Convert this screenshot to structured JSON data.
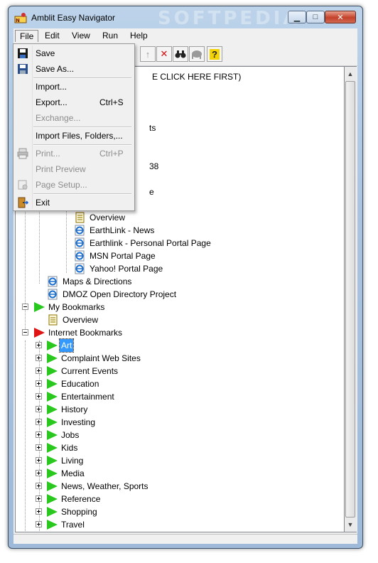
{
  "window": {
    "title": "Amblit Easy Navigator",
    "watermark": "SOFTPEDIA"
  },
  "menubar": [
    "File",
    "Edit",
    "View",
    "Run",
    "Help"
  ],
  "file_menu": [
    {
      "label": "Save",
      "shortcut": "",
      "enabled": true,
      "icon": "floppy-disk-icon"
    },
    {
      "label": "Save As...",
      "shortcut": "",
      "enabled": true,
      "icon": "save-as-icon"
    },
    {
      "label": "Import...",
      "shortcut": "",
      "enabled": true
    },
    {
      "label": "Export...",
      "shortcut": "Ctrl+S",
      "enabled": true
    },
    {
      "label": "Exchange...",
      "shortcut": "",
      "enabled": false
    },
    {
      "label": "Import Files, Folders,...",
      "shortcut": "",
      "enabled": true
    },
    {
      "label": "Print...",
      "shortcut": "Ctrl+P",
      "enabled": false,
      "icon": "printer-icon"
    },
    {
      "label": "Print Preview",
      "shortcut": "",
      "enabled": false
    },
    {
      "label": "Page Setup...",
      "shortcut": "",
      "enabled": false,
      "icon": "page-setup-icon"
    },
    {
      "label": "Exit",
      "shortcut": "",
      "enabled": true,
      "icon": "exit-door-icon"
    }
  ],
  "toolbar_icons": [
    "move-up-icon",
    "delete-x-icon",
    "binoculars-find-icon",
    "elephant-icon",
    "help-question-icon"
  ],
  "tree": {
    "partial_top": "E CLICK HERE FIRST)",
    "partial_fragments": [
      "ts",
      "38",
      "e"
    ],
    "items": [
      {
        "label": "Overview",
        "icon": "document-icon"
      },
      {
        "label": "EarthLink - News",
        "icon": "ie-link-icon"
      },
      {
        "label": "Earthlink - Personal Portal Page",
        "icon": "ie-link-icon"
      },
      {
        "label": "MSN Portal Page",
        "icon": "ie-link-icon"
      },
      {
        "label": "Yahoo! Portal Page",
        "icon": "ie-link-icon"
      },
      {
        "label": "Maps & Directions",
        "icon": "ie-link-icon"
      },
      {
        "label": "DMOZ Open Directory Project",
        "icon": "ie-link-icon"
      },
      {
        "label": "My Bookmarks",
        "icon": "green-flag-icon"
      },
      {
        "label": "Overview",
        "icon": "document-icon"
      },
      {
        "label": "Internet Bookmarks",
        "icon": "red-flag-icon"
      }
    ],
    "categories": [
      "Art",
      "Complaint Web Sites",
      "Current Events",
      "Education",
      "Entertainment",
      "History",
      "Investing",
      "Jobs",
      "Kids",
      "Living",
      "Media",
      "News, Weather, Sports",
      "Reference",
      "Shopping",
      "Travel"
    ],
    "selected": "Art"
  },
  "colors": {
    "selection": "#3399ff",
    "green_flag": "#28c81e",
    "red_flag": "#e01414"
  }
}
